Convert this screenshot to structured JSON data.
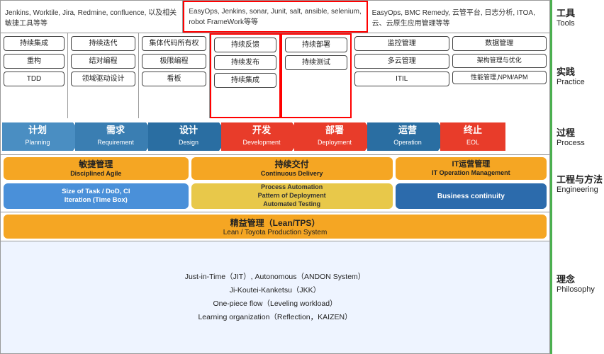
{
  "tools": {
    "col1": "Jenkins, Worktile, Jira, Redmine, confluence, 以及相关敏捷工具等等",
    "col2": "EasyOps, Jenkins, sonar, Junit, salt, ansible, selenium, robot FrameWork等等",
    "col3": "EasyOps, BMC Remedy, 云管平台, 日志分析, ITOA, 云、云原生应用管理等等"
  },
  "practice": {
    "col1": {
      "rows": [
        "持续集成",
        "重构",
        "TDD"
      ]
    },
    "col2": {
      "rows": [
        "持续迭代",
        "结对编程",
        "领域驱动设计"
      ]
    },
    "col3": {
      "rows": [
        "集体代码所有权",
        "极限编程",
        "看板"
      ]
    },
    "col4": {
      "rows": [
        "持续反馈",
        "持续发布",
        "持续集成"
      ]
    },
    "col5": {
      "rows": [
        "持续部署",
        "持续测试"
      ]
    },
    "col6_left": {
      "rows": [
        "监控管理",
        "多云管理",
        "ITIL"
      ]
    },
    "col6_right": {
      "rows": [
        "数据管理",
        "架构管理与优化",
        "性能管理,NPM/APM"
      ]
    },
    "label_zh": "实践",
    "label_en": "Practice"
  },
  "process": {
    "steps": [
      {
        "zh": "计划",
        "en": "Planning",
        "color": "#4A90D9"
      },
      {
        "zh": "需求",
        "en": "Requirement",
        "color": "#3A80C9"
      },
      {
        "zh": "设计",
        "en": "Design",
        "color": "#2A70B9"
      },
      {
        "zh": "开发",
        "en": "Development",
        "color": "#E8432A"
      },
      {
        "zh": "部署",
        "en": "Deployment",
        "color": "#E8432A"
      },
      {
        "zh": "运营",
        "en": "Operation",
        "color": "#2A70B9"
      },
      {
        "zh": "终止",
        "en": "EOL",
        "color": "#E8432A"
      }
    ],
    "label_zh": "过程",
    "label_en": "Process"
  },
  "engineering": {
    "top": {
      "agile": {
        "zh": "敏捷管理",
        "en": "Disciplined Agile"
      },
      "cd": {
        "zh": "持续交付",
        "en": "Continuous Delivery"
      },
      "it_ops": {
        "zh": "IT运营管理",
        "en": "IT Operation Management"
      }
    },
    "bottom": {
      "left": "Size of Task / DoD, CI\nIteration (Time Box)",
      "middle": "Process Automation\nPattern of Deployment\nAutomated Testing",
      "right": "Business continuity"
    },
    "label_zh": "工程与方法",
    "label_en": "Engineering"
  },
  "philosophy": {
    "lean_zh": "精益管理（Lean/TPS）",
    "lean_en": "Lean / Toyota Production System",
    "label_zh": "理念",
    "label_en": "Philosophy"
  },
  "principles": {
    "lines": [
      "Just-in-Time（JIT）, Autonomous（ANDON System）",
      "Ji-Koutei-Kanketsu（JKK）",
      "One-piece flow（Leveling workload）",
      "Learning organization（Reflection，KAIZEN）"
    ]
  },
  "right_labels": {
    "tools": {
      "zh": "工具",
      "en": "Tools"
    },
    "practice": {
      "zh": "实践",
      "en": "Practice"
    },
    "process": {
      "zh": "过程",
      "en": "Process"
    },
    "engineering": {
      "zh": "工程与方法",
      "en": "Engineering"
    },
    "philosophy": {
      "zh": "理念",
      "en": "Philosophy"
    }
  }
}
